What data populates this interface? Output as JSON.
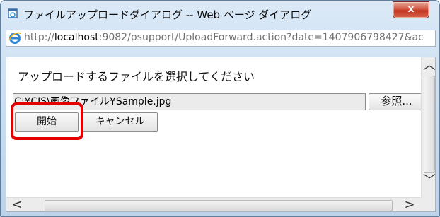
{
  "window": {
    "title": "ファイルアップロードダイアログ -- Web ページ ダイアログ",
    "close_label": "x"
  },
  "address": {
    "url_prefix": "http://",
    "url_host": "localhost",
    "url_rest": ":9082/psupport/UploadForward.action?date=1407906798427&ac"
  },
  "content": {
    "instruction": "アップロードするファイルを選択してください",
    "file_path": "C:¥CIS\\画像ファイル¥Sample.jpg",
    "browse_label": "参照...",
    "start_label": "開始",
    "cancel_label": "キャンセル"
  },
  "scrollbars": {
    "up": "︿",
    "down": "﹀",
    "left": "<",
    "right": ">"
  },
  "colors": {
    "highlight": "#e30000",
    "close_button": "#c2341e"
  },
  "icons": {
    "title": "ie-page-icon",
    "address": "ie-logo-icon"
  }
}
